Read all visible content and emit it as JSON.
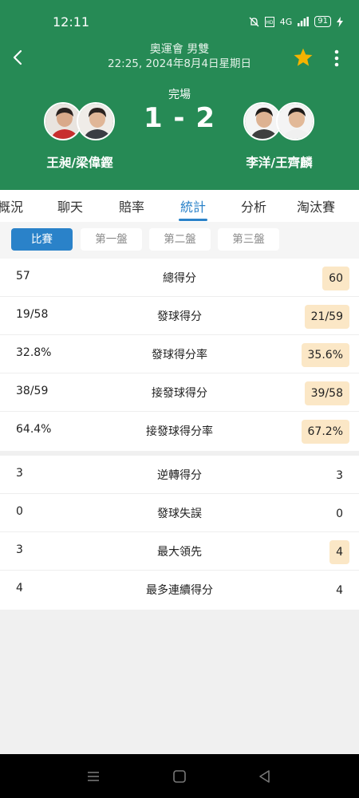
{
  "status_bar": {
    "time": "12:11",
    "signal": "4G",
    "battery": "91"
  },
  "header": {
    "title": "奧運會 男雙",
    "datetime": "22:25, 2024年8月4日星期日",
    "status": "完場",
    "score": "1 - 2",
    "home_team": "王昶/梁偉鏗",
    "away_team": "李洋/王齊麟",
    "star_color": "#f5b301"
  },
  "tabs": [
    "概況",
    "聊天",
    "賠率",
    "統計",
    "分析",
    "淘汰賽"
  ],
  "active_tab": "統計",
  "subtabs": [
    "比賽",
    "第一盤",
    "第二盤",
    "第三盤"
  ],
  "active_subtab": "比賽",
  "stats_group1": [
    {
      "label": "總得分",
      "home": "57",
      "away": "60",
      "highlight": "away"
    },
    {
      "label": "發球得分",
      "home": "19/58",
      "away": "21/59",
      "highlight": "away"
    },
    {
      "label": "發球得分率",
      "home": "32.8%",
      "away": "35.6%",
      "highlight": "away"
    },
    {
      "label": "接發球得分",
      "home": "38/59",
      "away": "39/58",
      "highlight": "away"
    },
    {
      "label": "接發球得分率",
      "home": "64.4%",
      "away": "67.2%",
      "highlight": "away"
    }
  ],
  "stats_group2": [
    {
      "label": "逆轉得分",
      "home": "3",
      "away": "3",
      "highlight": "none"
    },
    {
      "label": "發球失誤",
      "home": "0",
      "away": "0",
      "highlight": "none"
    },
    {
      "label": "最大領先",
      "home": "3",
      "away": "4",
      "highlight": "away"
    },
    {
      "label": "最多連續得分",
      "home": "4",
      "away": "4",
      "highlight": "none"
    }
  ],
  "colors": {
    "header_bg": "#268a55",
    "accent": "#2a82c9",
    "highlight": "#fbe7c6"
  }
}
